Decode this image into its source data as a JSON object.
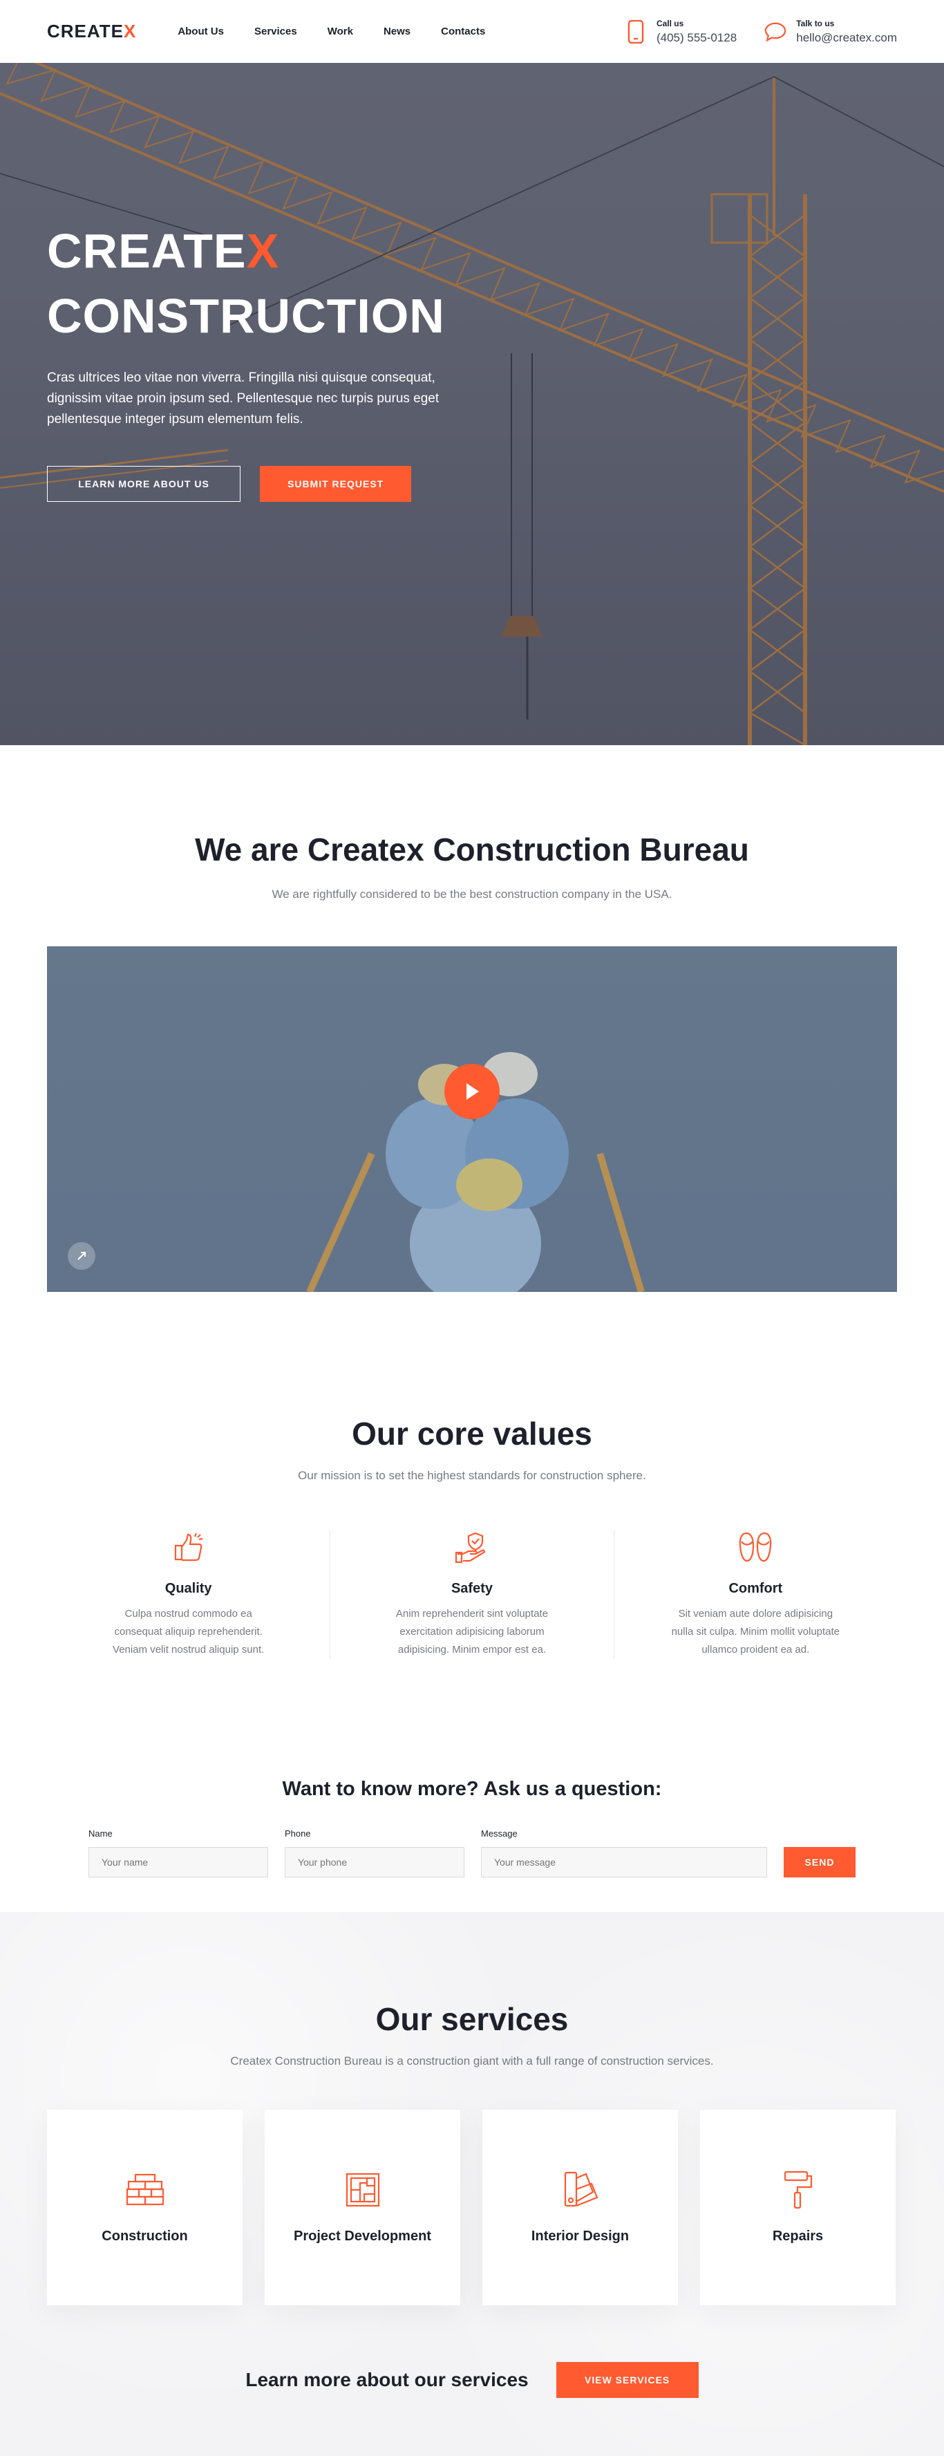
{
  "header": {
    "logo_main": "CREATE",
    "logo_accent": "X",
    "nav": [
      "About Us",
      "Services",
      "Work",
      "News",
      "Contacts"
    ],
    "call_label": "Call us",
    "call_value": "(405) 555-0128",
    "talk_label": "Talk to us",
    "talk_value": "hello@createx.com"
  },
  "hero": {
    "title_line1_main": "CREATE",
    "title_line1_accent": "X",
    "title_line2": "CONSTRUCTION",
    "description": "Cras ultrices leo vitae non viverra. Fringilla nisi quisque consequat, dignissim vitae proin ipsum sed. Pellentesque nec turpis purus eget pellentesque integer ipsum elementum felis.",
    "btn_learn": "LEARN MORE ABOUT US",
    "btn_submit": "SUBMIT REQUEST"
  },
  "about": {
    "title": "We are Createx Construction Bureau",
    "subtitle": "We are rightfully considered to be the best construction company in the USA."
  },
  "values": {
    "title": "Our core values",
    "subtitle": "Our mission is to set the highest standards for construction sphere.",
    "items": [
      {
        "icon": "thumbs-up-icon",
        "title": "Quality",
        "text": "Culpa nostrud commodo ea consequat aliquip reprehenderit. Veniam velit nostrud aliquip sunt."
      },
      {
        "icon": "shield-hand-icon",
        "title": "Safety",
        "text": "Anim reprehenderit sint voluptate exercitation adipisicing laborum adipisicing. Minim empor est ea."
      },
      {
        "icon": "slippers-icon",
        "title": "Comfort",
        "text": "Sit veniam aute dolore adipisicing nulla sit culpa. Minim mollit voluptate ullamco proident ea ad."
      }
    ]
  },
  "ask": {
    "title": "Want to know more? Ask us a question:",
    "name_label": "Name",
    "name_placeholder": "Your name",
    "phone_label": "Phone",
    "phone_placeholder": "Your phone",
    "message_label": "Message",
    "message_placeholder": "Your message",
    "send": "SEND"
  },
  "services": {
    "title": "Our services",
    "subtitle": "Createx Construction Bureau is a construction giant with a full range of construction services.",
    "items": [
      {
        "icon": "bricks-icon",
        "title": "Construction"
      },
      {
        "icon": "blueprint-icon",
        "title": "Project Development"
      },
      {
        "icon": "color-palette-icon",
        "title": "Interior Design"
      },
      {
        "icon": "paint-roller-icon",
        "title": "Repairs"
      }
    ],
    "more_text": "Learn more about our services",
    "more_btn": "VIEW SERVICES"
  },
  "colors": {
    "accent": "#ff5a30",
    "dark": "#1e212c",
    "gray": "#787a80"
  }
}
